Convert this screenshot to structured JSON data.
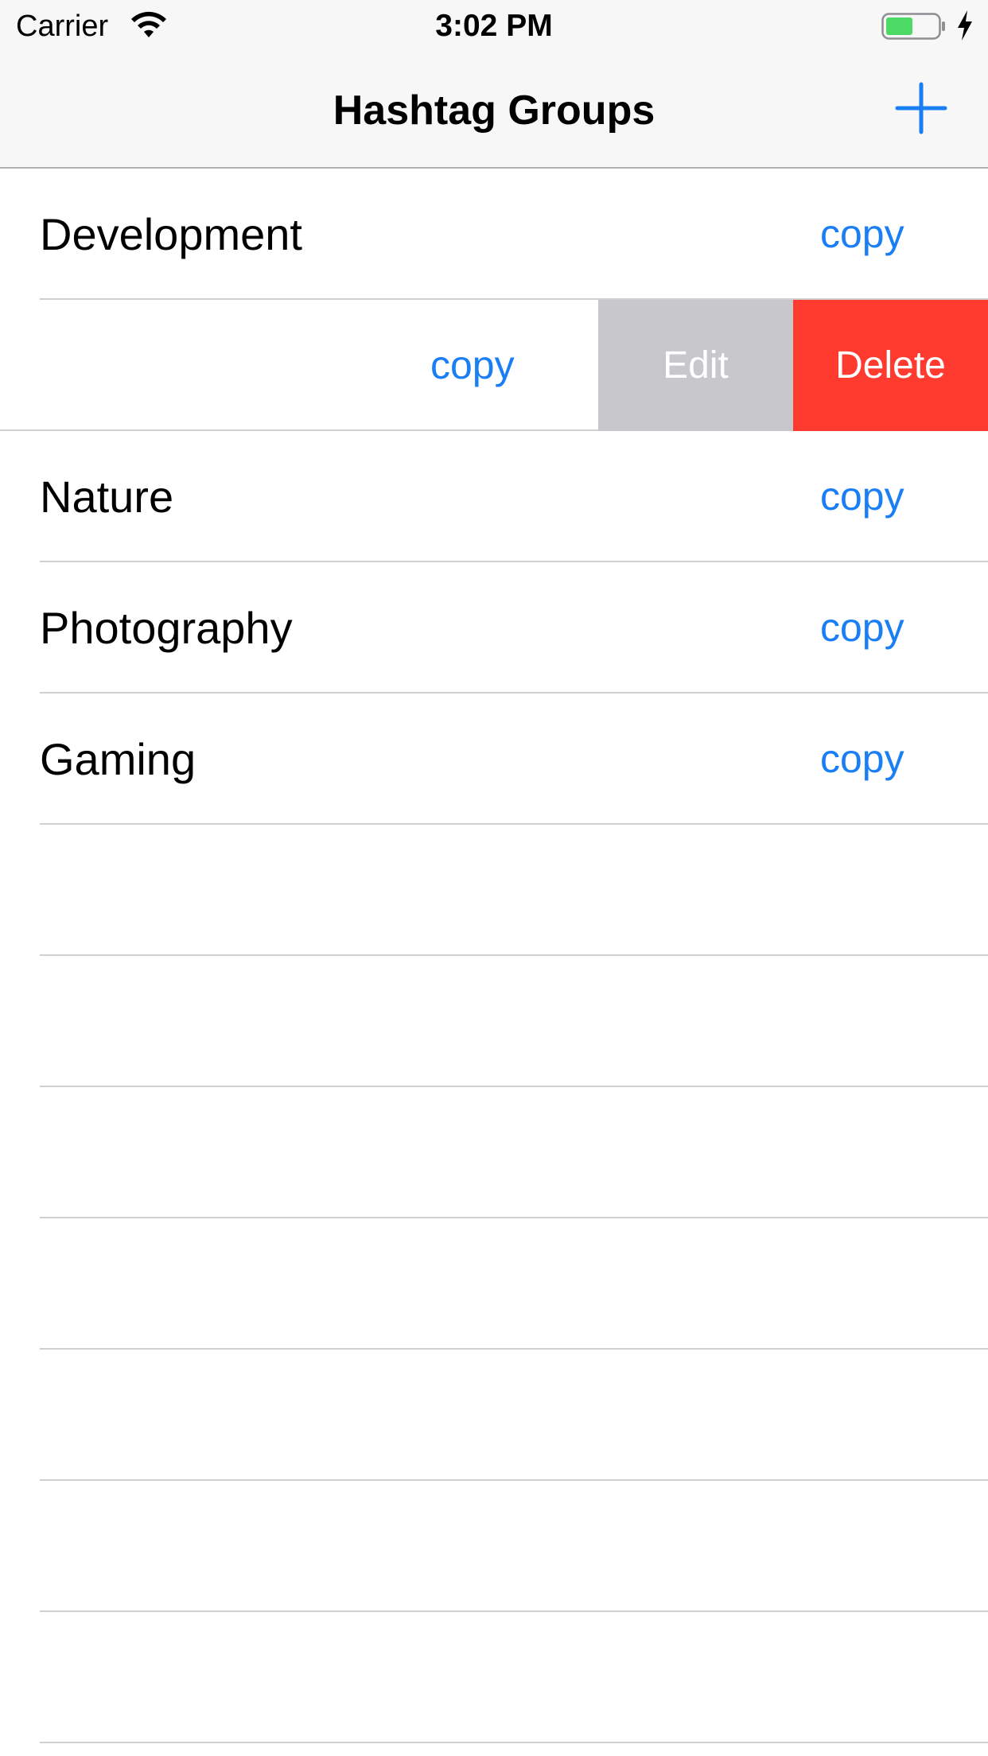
{
  "status_bar": {
    "carrier": "Carrier",
    "time": "3:02 PM",
    "wifi_icon": "wifi-icon",
    "battery_icon": "battery-charging-icon"
  },
  "nav": {
    "title": "Hashtag Groups",
    "add_icon": "plus-icon"
  },
  "colors": {
    "accent": "#1a7ef5",
    "delete": "#ff3b30",
    "edit": "#c7c7cc",
    "battery": "#4cd964"
  },
  "rows": [
    {
      "title": "Development",
      "action": "copy"
    },
    {
      "title": "",
      "action": "copy",
      "swiped": true,
      "edit_label": "Edit",
      "delete_label": "Delete"
    },
    {
      "title": "Nature",
      "action": "copy"
    },
    {
      "title": "Photography",
      "action": "copy"
    },
    {
      "title": "Gaming",
      "action": "copy"
    }
  ]
}
